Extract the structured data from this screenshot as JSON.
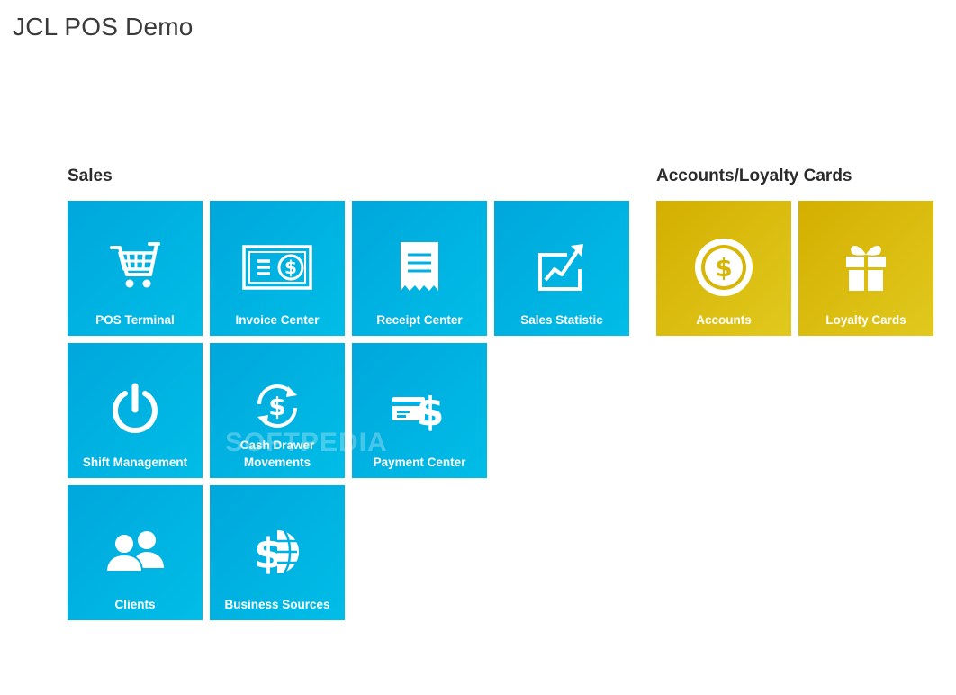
{
  "app": {
    "title": "JCL POS Demo"
  },
  "groups": {
    "sales": {
      "title": "Sales",
      "tiles": {
        "pos_terminal": {
          "label": "POS Terminal",
          "icon": "shopping-cart-icon"
        },
        "invoice_center": {
          "label": "Invoice Center",
          "icon": "banknote-icon"
        },
        "receipt_center": {
          "label": "Receipt Center",
          "icon": "receipt-icon"
        },
        "sales_statistic": {
          "label": "Sales Statistic",
          "icon": "chart-up-icon"
        },
        "shift_management": {
          "label": "Shift Management",
          "icon": "power-icon"
        },
        "cash_drawer_movements": {
          "label": "Cash Drawer\nMovements",
          "icon": "dollar-cycle-icon"
        },
        "payment_center": {
          "label": "Payment Center",
          "icon": "card-dollar-icon"
        },
        "clients": {
          "label": "Clients",
          "icon": "users-icon"
        },
        "business_sources": {
          "label": "Business Sources",
          "icon": "globe-dollar-icon"
        }
      }
    },
    "accounts": {
      "title": "Accounts/Loyalty Cards",
      "tiles": {
        "accounts": {
          "label": "Accounts",
          "icon": "coin-icon"
        },
        "loyalty_cards": {
          "label": "Loyalty Cards",
          "icon": "gift-icon"
        }
      }
    }
  },
  "watermark": "SOFTPEDIA",
  "colors": {
    "tile_blue": "#00b3e3",
    "tile_gold": "#d9bd10",
    "title_text": "#3a3a3a"
  }
}
